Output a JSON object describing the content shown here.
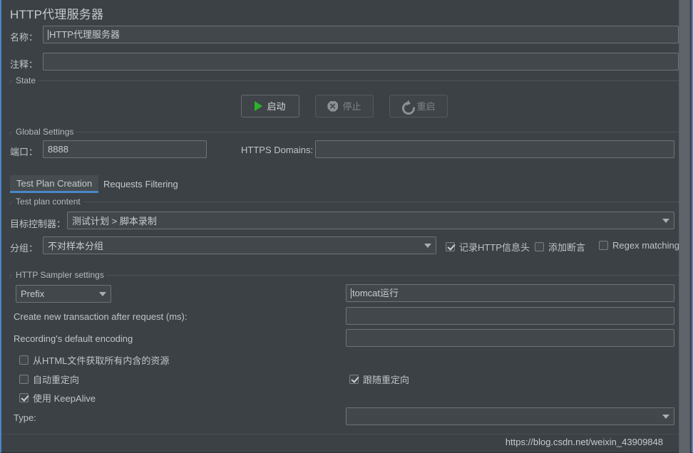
{
  "window": {
    "title": "HTTP代理服务器",
    "accent_color": "#4A88C7",
    "background_color": "#3C4145"
  },
  "header": {
    "name_label": "名称：",
    "name_value": "HTTP代理服务器",
    "comment_label": "注释：",
    "comment_value": ""
  },
  "state_group": {
    "legend": "State",
    "buttons": [
      {
        "label": "启动",
        "icon": "play-icon",
        "enabled": true
      },
      {
        "label": "停止",
        "icon": "stop-icon",
        "enabled": false
      },
      {
        "label": "重启",
        "icon": "restart-icon",
        "enabled": false
      }
    ]
  },
  "global_settings": {
    "legend": "Global Settings",
    "port_label": "端口：",
    "port_value": "8888",
    "https_domains_label": "HTTPS Domains:",
    "https_domains_value": ""
  },
  "tabs": [
    {
      "label": "Test Plan Creation",
      "active": true
    },
    {
      "label": "Requests Filtering",
      "active": false
    }
  ],
  "test_plan_content": {
    "legend": "Test plan content",
    "target_controller_label": "目标控制器：",
    "target_controller_value": "测试计划 > 脚本录制",
    "grouping_label": "分组：",
    "grouping_value": "不对样本分组",
    "checkboxes": [
      {
        "label": "记录HTTP信息头",
        "checked": true
      },
      {
        "label": "添加断言",
        "checked": false
      },
      {
        "label": "Regex matching",
        "checked": false
      }
    ]
  },
  "sampler_settings": {
    "legend": "HTTP Sampler settings",
    "prefix_mode_value": "Prefix",
    "prefix_value": "tomcat运行",
    "transaction_label": "Create new transaction after request (ms):",
    "transaction_value": "",
    "encoding_label": "Recording's default encoding",
    "encoding_value": "",
    "checkboxes": [
      {
        "label": "从HTML文件获取所有内含的资源",
        "checked": false
      },
      {
        "label": "自动重定向",
        "checked": false
      },
      {
        "label": "跟随重定向",
        "checked": true
      },
      {
        "label": "使用 KeepAlive",
        "checked": true
      }
    ],
    "type_label": "Type:",
    "type_value": ""
  },
  "watermark": "https://blog.csdn.net/weixin_43909848"
}
